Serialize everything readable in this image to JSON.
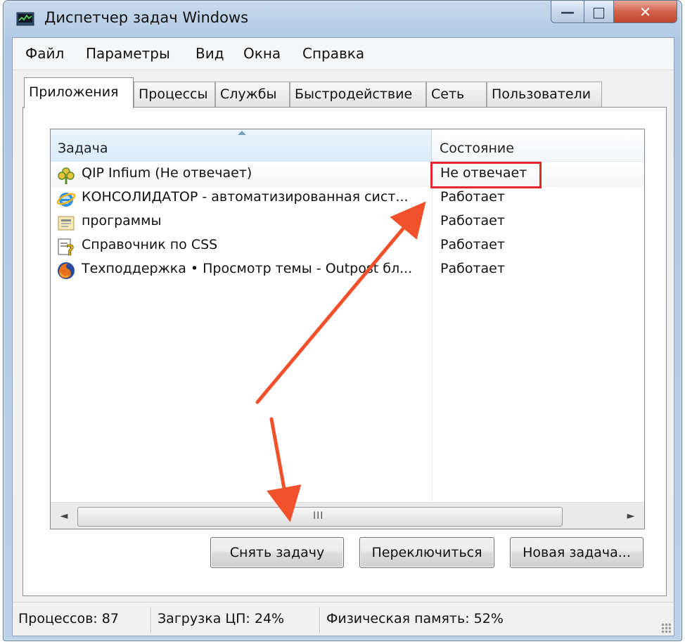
{
  "window": {
    "title": "Диспетчер задач Windows",
    "caption": {
      "minimize": "—",
      "maximize": "□",
      "close": "✕"
    }
  },
  "menu": [
    "Файл",
    "Параметры",
    "Вид",
    "Окна",
    "Справка"
  ],
  "tabs": [
    "Приложения",
    "Процессы",
    "Службы",
    "Быстродействие",
    "Сеть",
    "Пользователи"
  ],
  "active_tab": "Приложения",
  "list": {
    "columns": {
      "task": "Задача",
      "state": "Состояние"
    },
    "rows": [
      {
        "name": "QIP Infium (Не отвечает)",
        "status": "Не отвечает",
        "icon": "qip-flower-icon"
      },
      {
        "name": "КОНСОЛИДАТОР - автоматизированная сист...",
        "status": "Работает",
        "icon": "internet-explorer-icon"
      },
      {
        "name": "программы",
        "status": "Работает",
        "icon": "folder-document-icon"
      },
      {
        "name": "Справочник по CSS",
        "status": "Работает",
        "icon": "help-document-icon"
      },
      {
        "name": "Техподдержка • Просмотр темы - Outpost бл...",
        "status": "Работает",
        "icon": "firefox-icon"
      }
    ],
    "scroll_left": "◄",
    "scroll_right": "►",
    "scroll_grip": "III"
  },
  "buttons": {
    "end_task": "Снять задачу",
    "switch_to": "Переключиться",
    "new_task": "Новая задача..."
  },
  "status": {
    "processes": "Процессов: 87",
    "cpu": "Загрузка ЦП: 24%",
    "memory": "Физическая память: 52%"
  },
  "colors": {
    "annotation": "#e4262d",
    "arrow": "#f0502a"
  }
}
